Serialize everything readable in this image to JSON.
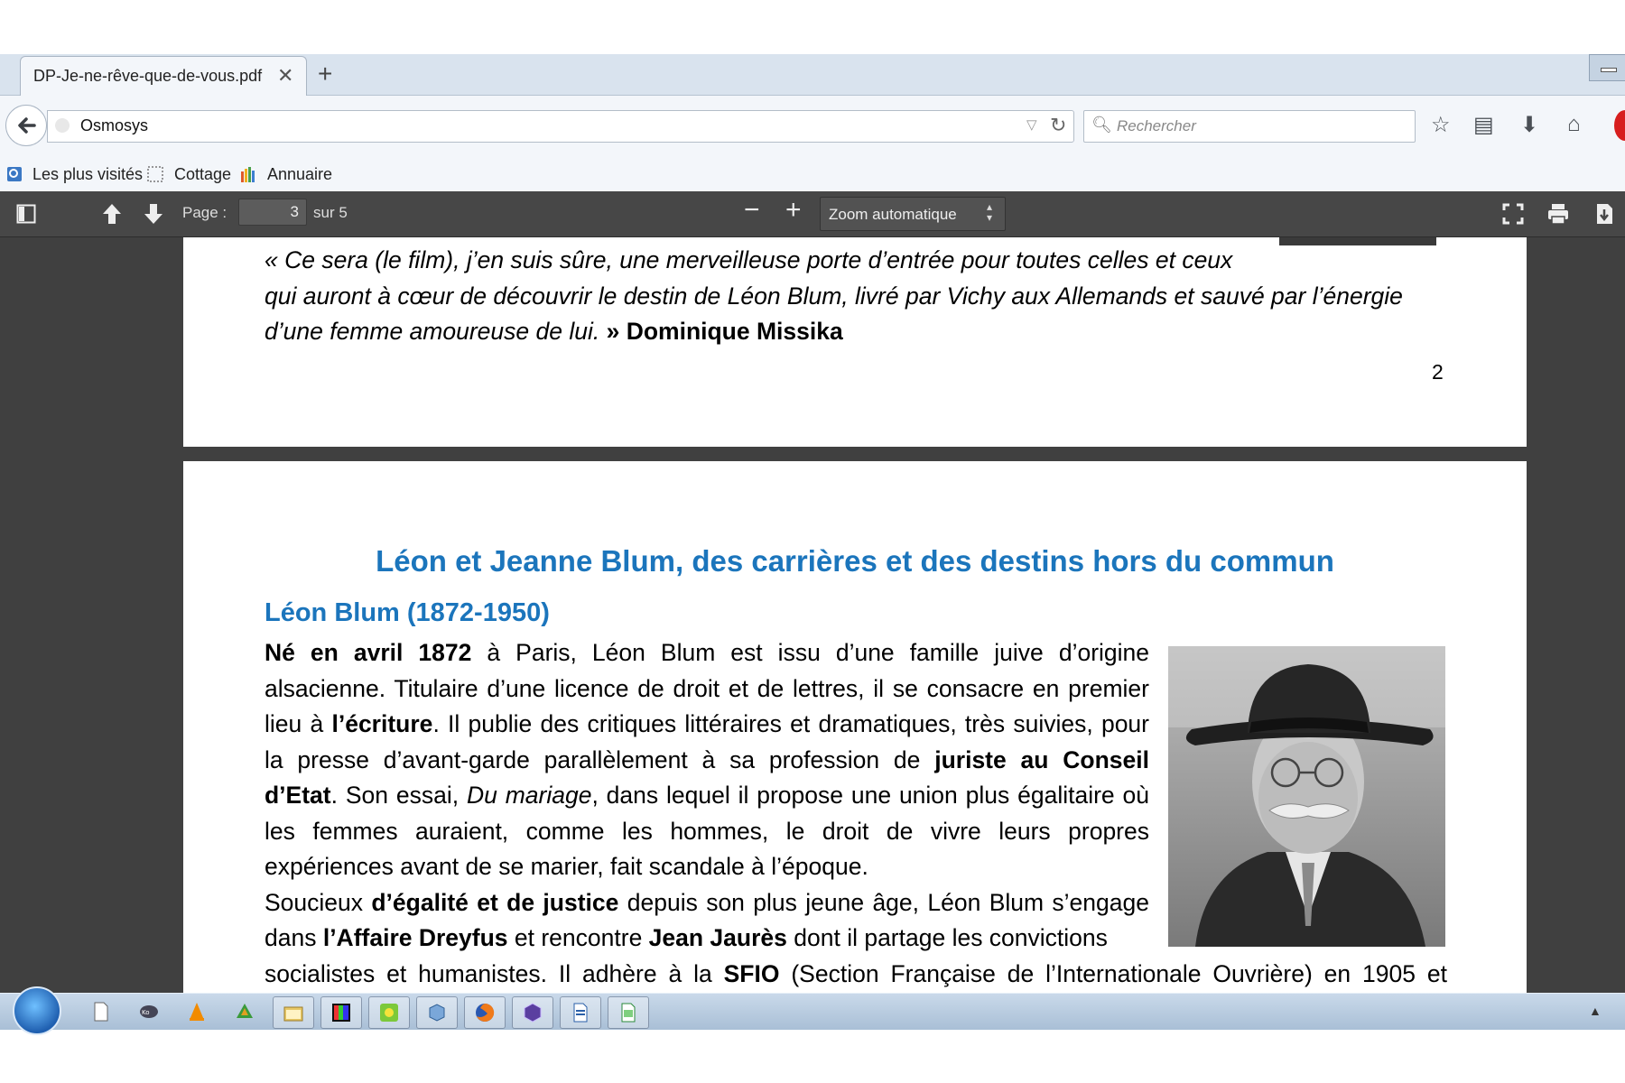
{
  "browser": {
    "tab_title": "DP-Je-ne-rêve-que-de-vous.pdf",
    "tab_close": "✕",
    "new_tab": "+",
    "url": "Osmosys",
    "search_placeholder": "Rechercher",
    "bookmarks": [
      {
        "label": "Les plus visités",
        "icon": "most-visited-icon"
      },
      {
        "label": "Cottage",
        "icon": "folder-dotted-icon"
      },
      {
        "label": "Annuaire",
        "icon": "directory-icon"
      }
    ],
    "toolbar_icons": [
      "star-icon",
      "reading-list-icon",
      "download-icon",
      "home-icon"
    ]
  },
  "pdf_toolbar": {
    "page_label": "Page :",
    "page_current": "3",
    "page_of": "sur 5",
    "zoom": "Zoom automatique",
    "zoom_out": "−",
    "zoom_in": "+"
  },
  "pdf": {
    "page2": {
      "quote_line1": "« Ce sera (le film), j’en suis sûre, une merveilleuse porte d’entrée pour toutes celles et ceux",
      "quote_line2": "qui auront à cœur de découvrir le destin de Léon Blum, livré par Vichy aux Allemands et sauvé par l’énergie",
      "quote_line3": "d’une femme amoureuse de lui.",
      "quote_close": " » ",
      "quote_author": "Dominique Missika",
      "page_number": "2"
    },
    "page3": {
      "title": "Léon et Jeanne Blum, des carrières et des destins hors du commun",
      "subtitle": "Léon Blum (1872-1950)",
      "p1": {
        "b1": "Né en avril 1872",
        "t1": " à Paris, Léon Blum est issu d’une famille juive d’origine alsacienne. Titulaire d’une licence de droit et de lettres, il se consacre en premier lieu à ",
        "b2": "l’écriture",
        "t2": ". Il publie des critiques littéraires et dramatiques, très suivies, pour la presse d’avant-garde parallèlement à sa profession de ",
        "b3": "juriste au Conseil d’Etat",
        "t3": ". Son essai, ",
        "i1": "Du mariage",
        "t4": ", dans lequel il propose une union plus égalitaire où les femmes auraient, comme les hommes, le droit de vivre leurs propres expériences avant de se marier, fait scandale à l’époque."
      },
      "p2": {
        "t1": "Soucieux ",
        "b1": "d’égalité et de justice",
        "t2": " depuis son plus jeune âge, Léon Blum s’engage dans ",
        "b2": "l’Affaire Dreyfus",
        "t3": " et rencontre ",
        "b3": "Jean Jaurès",
        "t4": " dont il partage les convictions"
      },
      "p2_last": {
        "t1": "socialistes et humanistes. Il adhère à la ",
        "b1": "SFIO",
        "t2": " (Section Française de l’Internationale Ouvrière) en 1905 et"
      },
      "photo": "portrait-photo-leon-blum"
    }
  },
  "taskbar": {
    "start": "windows-start-icon",
    "apps": [
      "notepad-icon",
      "app-logo-icon",
      "vlc-icon",
      "recycle-icon",
      "file-manager-icon",
      "color-app-icon",
      "green-app-icon",
      "virtualbox-icon",
      "firefox-icon",
      "hexagon-app-icon",
      "writer-icon",
      "calc-icon"
    ],
    "tray_arrow": "▲"
  }
}
